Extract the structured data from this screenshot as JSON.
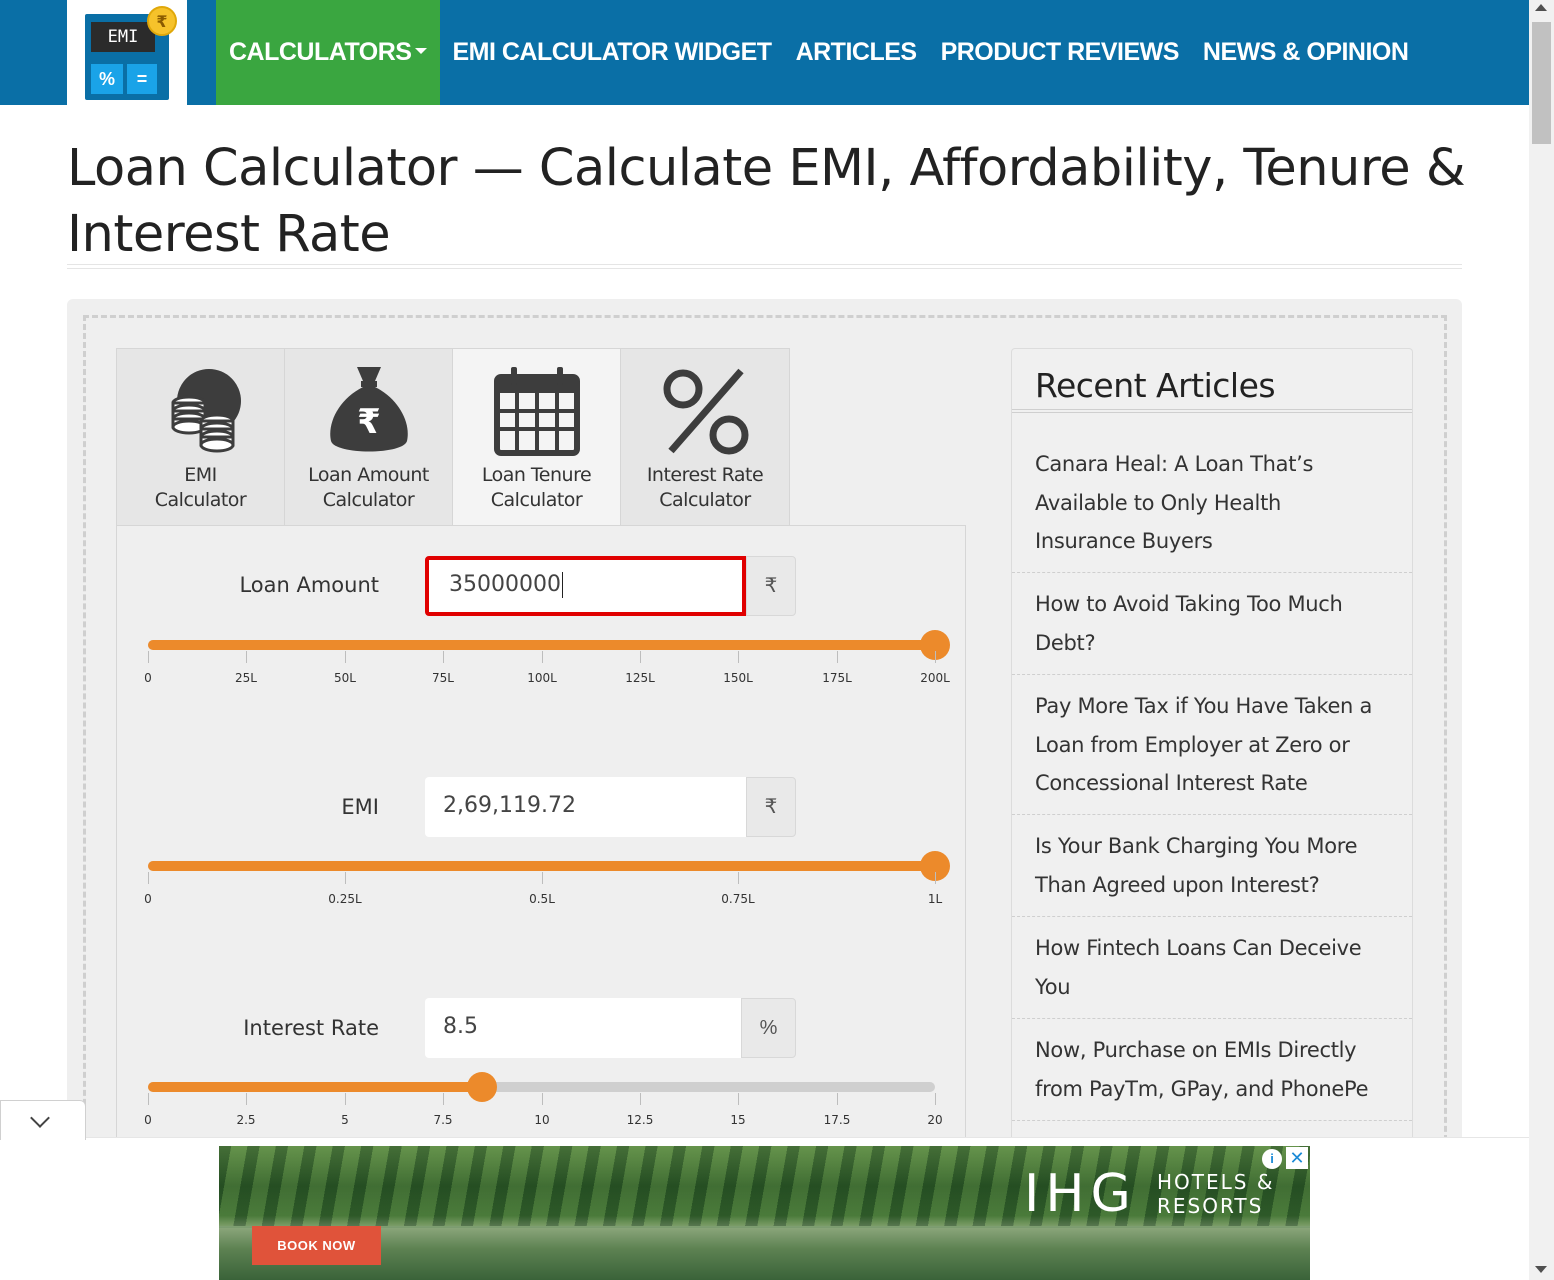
{
  "logo": {
    "screen_text": "EMI",
    "key_left": "%",
    "key_right": "=",
    "coin": "₹"
  },
  "nav": {
    "items": [
      {
        "label": "CALCULATORS",
        "active": true,
        "has_dropdown": true
      },
      {
        "label": "EMI CALCULATOR WIDGET"
      },
      {
        "label": "ARTICLES"
      },
      {
        "label": "PRODUCT REVIEWS"
      },
      {
        "label": "NEWS & OPINION"
      }
    ],
    "colors": {
      "bar": "#0a6fa6",
      "active": "#3aa640"
    }
  },
  "page_title": "Loan Calculator — Calculate EMI, Affordability, Tenure & Interest Rate",
  "tabs": [
    {
      "line1": "EMI",
      "line2": "Calculator",
      "icon": "coins-icon"
    },
    {
      "line1": "Loan Amount",
      "line2": "Calculator",
      "icon": "money-bag-icon"
    },
    {
      "line1": "Loan Tenure",
      "line2": "Calculator",
      "icon": "calendar-icon",
      "active": true
    },
    {
      "line1": "Interest Rate",
      "line2": "Calculator",
      "icon": "percent-icon"
    }
  ],
  "fields": {
    "loan_amount": {
      "label": "Loan Amount",
      "value": "35000000",
      "unit": "₹",
      "slider_fraction": 1.0,
      "ticks": [
        "0",
        "25L",
        "50L",
        "75L",
        "100L",
        "125L",
        "150L",
        "175L",
        "200L"
      ]
    },
    "emi": {
      "label": "EMI",
      "value": "2,69,119.72",
      "unit": "₹",
      "slider_fraction": 1.0,
      "ticks": [
        "0",
        "0.25L",
        "0.5L",
        "0.75L",
        "1L"
      ]
    },
    "interest_rate": {
      "label": "Interest Rate",
      "value": "8.5",
      "unit": "%",
      "slider_fraction": 0.425,
      "ticks": [
        "0",
        "2.5",
        "5",
        "7.5",
        "10",
        "12.5",
        "15",
        "17.5",
        "20"
      ]
    }
  },
  "sidebar": {
    "title": "Recent Articles",
    "articles": [
      {
        "lines": [
          "Canara Heal: A Loan That’s",
          "Available to Only Health",
          "Insurance Buyers"
        ]
      },
      {
        "lines": [
          "How to Avoid Taking Too Much",
          "Debt?"
        ]
      },
      {
        "lines": [
          "Pay More Tax if You Have Taken a",
          "Loan from Employer at Zero or",
          "Concessional Interest Rate"
        ]
      },
      {
        "lines": [
          "Is Your Bank Charging You More",
          "Than Agreed upon Interest?"
        ]
      },
      {
        "lines": [
          "How Fintech Loans Can Deceive",
          "You"
        ]
      },
      {
        "lines": [
          "Now, Purchase on EMIs Directly",
          "from PayTm, GPay, and PhonePe"
        ]
      }
    ]
  },
  "ad": {
    "button": "BOOK NOW",
    "brand": "IHG",
    "brand_line1": "HOTELS &",
    "brand_line2": "RESORTS",
    "info": "i",
    "close": "✕"
  },
  "accent_color": "#ec8a2b",
  "focus_color": "#e00000"
}
